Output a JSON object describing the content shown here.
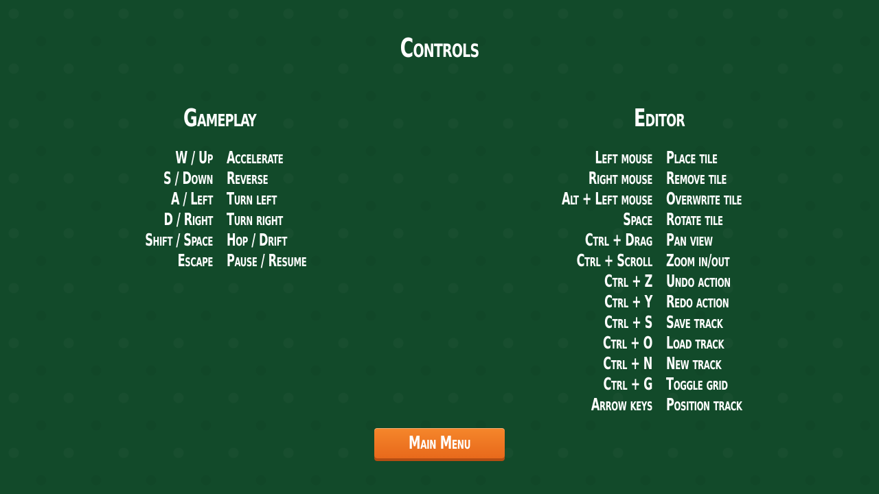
{
  "screen_title": "Controls",
  "gameplay": {
    "title": "Gameplay",
    "bindings": [
      {
        "key": "W / Up",
        "action": "Accelerate"
      },
      {
        "key": "S / Down",
        "action": "Reverse"
      },
      {
        "key": "A / Left",
        "action": "Turn left"
      },
      {
        "key": "D / Right",
        "action": "Turn right"
      },
      {
        "key": "Shift / Space",
        "action": "Hop / Drift"
      },
      {
        "key": "Escape",
        "action": "Pause / Resume"
      }
    ]
  },
  "editor": {
    "title": "Editor",
    "bindings": [
      {
        "key": "Left mouse",
        "action": "Place tile"
      },
      {
        "key": "Right mouse",
        "action": "Remove tile"
      },
      {
        "key": "Alt + Left mouse",
        "action": "Overwrite tile"
      },
      {
        "key": "Space",
        "action": "Rotate tile"
      },
      {
        "key": "Ctrl + Drag",
        "action": "Pan view"
      },
      {
        "key": "Ctrl + Scroll",
        "action": "Zoom in/out"
      },
      {
        "key": "Ctrl + Z",
        "action": "Undo action"
      },
      {
        "key": "Ctrl + Y",
        "action": "Redo action"
      },
      {
        "key": "Ctrl + S",
        "action": "Save track"
      },
      {
        "key": "Ctrl + O",
        "action": "Load track"
      },
      {
        "key": "Ctrl + N",
        "action": "New track"
      },
      {
        "key": "Ctrl + G",
        "action": "Toggle grid"
      },
      {
        "key": "Arrow keys",
        "action": "Position track"
      }
    ]
  },
  "main_menu_button": {
    "label": "Main Menu"
  },
  "colors": {
    "background": "#124a2a",
    "text": "#ffffff",
    "button": "#f07a25"
  }
}
